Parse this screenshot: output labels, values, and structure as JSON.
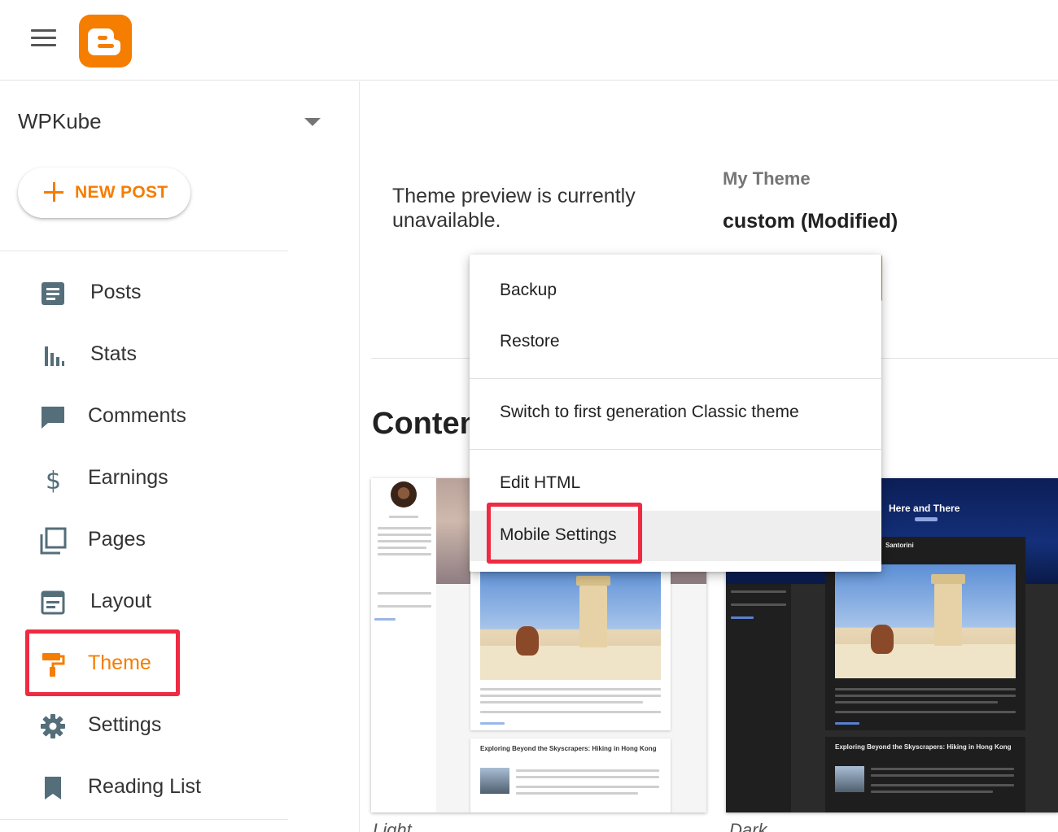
{
  "header": {
    "menu_icon": "hamburger-menu-icon",
    "logo_icon": "blogger-logo-icon"
  },
  "sidebar": {
    "blog_name": "WPKube",
    "new_post_label": "NEW POST",
    "items": [
      {
        "label": "Posts",
        "icon": "posts-icon"
      },
      {
        "label": "Stats",
        "icon": "stats-icon"
      },
      {
        "label": "Comments",
        "icon": "comments-icon"
      },
      {
        "label": "Earnings",
        "icon": "dollar-icon"
      },
      {
        "label": "Pages",
        "icon": "pages-icon"
      },
      {
        "label": "Layout",
        "icon": "layout-icon"
      },
      {
        "label": "Theme",
        "icon": "paint-roller-icon",
        "active": true
      },
      {
        "label": "Settings",
        "icon": "gear-icon"
      },
      {
        "label": "Reading List",
        "icon": "bookmark-icon"
      }
    ]
  },
  "main": {
    "preview_message": "Theme preview is currently unavailable.",
    "my_theme_label": "My Theme",
    "current_theme": "custom (Modified)",
    "contents_heading": "Conten",
    "cards": [
      {
        "caption": "Light",
        "post_title": "Exploring Beyond the Skyscrapers: Hiking in Hong Kong"
      },
      {
        "caption": "Dark",
        "blog_title": "Here and There",
        "featured_post": "Santorini",
        "post_title": "Exploring Beyond the Skyscrapers: Hiking in Hong Kong"
      }
    ]
  },
  "menu": {
    "items": [
      {
        "label": "Backup"
      },
      {
        "label": "Restore"
      },
      {
        "label": "Switch to first generation Classic theme"
      },
      {
        "label": "Edit HTML"
      },
      {
        "label": "Mobile Settings",
        "hovered": true
      }
    ]
  },
  "colors": {
    "accent": "#f57d00",
    "highlight": "#ee2b43",
    "text": "#212121",
    "icon": "#546e7a"
  }
}
